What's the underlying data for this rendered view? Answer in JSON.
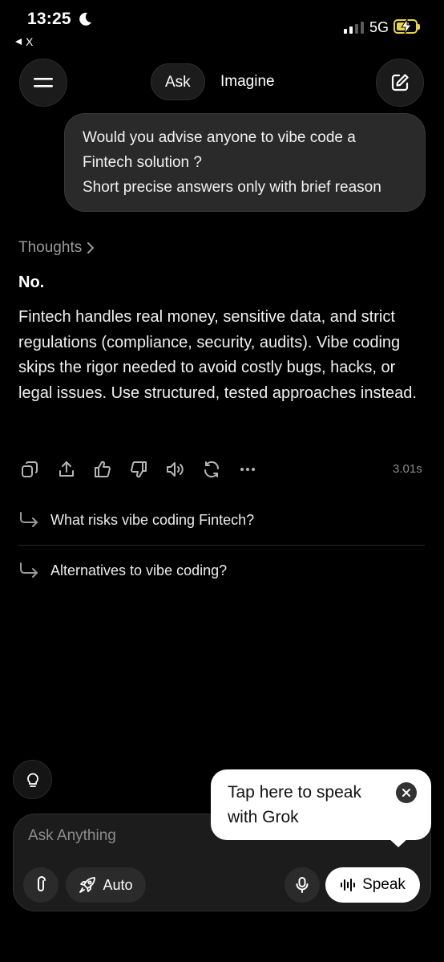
{
  "status_bar": {
    "time": "13:25",
    "back_label": "X",
    "network": "5G",
    "icons": [
      "moon-icon",
      "signal-icon",
      "battery-charging-icon"
    ]
  },
  "nav": {
    "tabs": [
      {
        "label": "Ask",
        "selected": true
      },
      {
        "label": "Imagine",
        "selected": false
      }
    ],
    "icons": [
      "menu-icon",
      "new-chat-icon"
    ]
  },
  "conversation": {
    "user_message": [
      "Would you advise anyone to vibe code a",
      "Fintech solution ?",
      "Short precise answers only with brief reason"
    ],
    "thoughts_label": "Thoughts",
    "answer_title": "No.",
    "answer_body": "Fintech handles real money, sensitive data, and strict regulations (compliance, security, audits). Vibe coding skips the rigor needed to avoid costly bugs, hacks, or legal issues. Use structured, tested approaches instead.",
    "response_time": "3.01s",
    "actions": [
      "copy-icon",
      "share-icon",
      "thumbs-up-icon",
      "thumbs-down-icon",
      "read-aloud-icon",
      "regenerate-icon",
      "more-icon"
    ]
  },
  "suggestions": [
    "What risks vibe coding Fintech?",
    "Alternatives to vibe coding?"
  ],
  "composer": {
    "placeholder": "Ask Anything",
    "auto_label": "Auto",
    "speak_label": "Speak"
  },
  "tooltip": {
    "text": "Tap here to speak with Grok"
  }
}
